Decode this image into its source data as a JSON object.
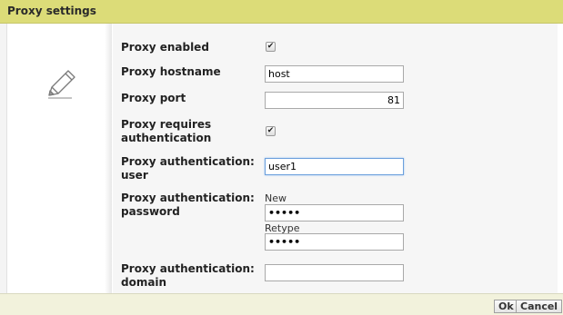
{
  "dialog": {
    "title": "Proxy settings"
  },
  "fields": {
    "proxy_enabled": {
      "label": "Proxy enabled",
      "checked": true
    },
    "proxy_hostname": {
      "label": "Proxy hostname",
      "value": "host"
    },
    "proxy_port": {
      "label": "Proxy port",
      "value": "81"
    },
    "proxy_requires_auth": {
      "label_line1": "Proxy requires",
      "label_line2": "authentication",
      "checked": true
    },
    "proxy_auth_user": {
      "label_line1": "Proxy authentication:",
      "label_line2": "user",
      "value": "user1"
    },
    "proxy_auth_password": {
      "label_line1": "Proxy authentication:",
      "label_line2": "password",
      "new_label": "New",
      "new_value": "•••••",
      "retype_label": "Retype",
      "retype_value": "•••••"
    },
    "proxy_auth_domain": {
      "label_line1": "Proxy authentication:",
      "label_line2": "domain",
      "value": ""
    }
  },
  "buttons": {
    "ok": "Ok",
    "cancel": "Cancel"
  },
  "icons": {
    "edit": "pencil-icon",
    "check": "✔"
  }
}
